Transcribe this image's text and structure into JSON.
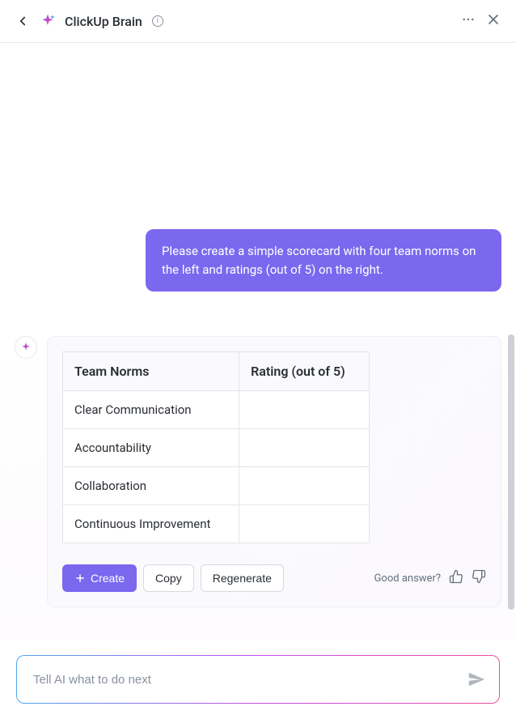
{
  "header": {
    "title": "ClickUp Brain"
  },
  "conversation": {
    "userMessage": "Please create a simple scorecard with four team norms on the left and ratings (out of 5) on the right."
  },
  "table": {
    "headers": {
      "col1": "Team Norms",
      "col2": "Rating (out of 5)"
    },
    "rows": [
      {
        "norm": "Clear Communication",
        "rating": ""
      },
      {
        "norm": "Accountability",
        "rating": ""
      },
      {
        "norm": "Collaboration",
        "rating": ""
      },
      {
        "norm": "Continuous Improvement",
        "rating": ""
      }
    ]
  },
  "actions": {
    "create": "Create",
    "copy": "Copy",
    "regenerate": "Regenerate",
    "feedback": "Good answer?"
  },
  "input": {
    "placeholder": "Tell AI what to do next"
  }
}
